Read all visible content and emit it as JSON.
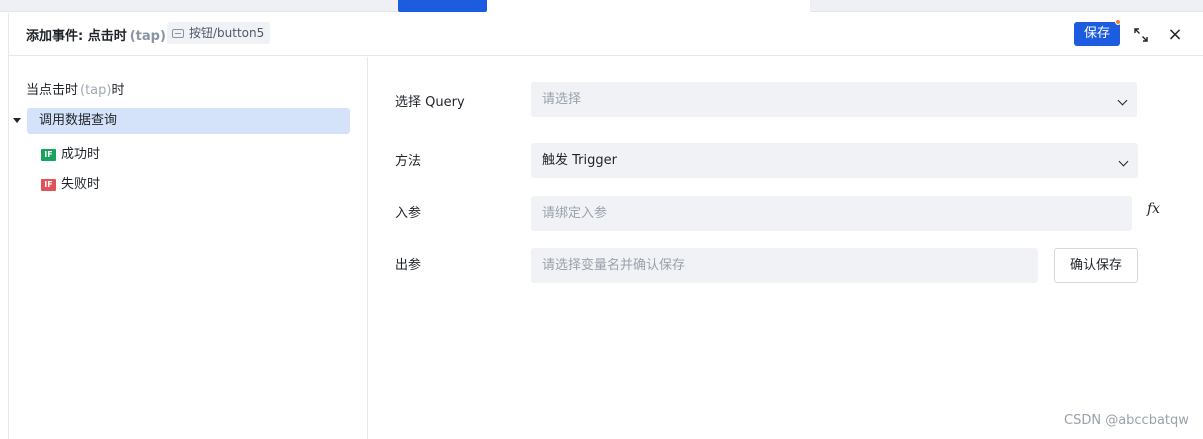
{
  "header": {
    "title": "添加事件: 点击时",
    "event_code": "(tap)",
    "component_tag": "按钮/button5",
    "save_label": "保存",
    "expand_icon": "expand-icon",
    "close_icon": "close-icon",
    "close_glyph": "×"
  },
  "tree": {
    "root_label": "当点击时",
    "root_code": "(tap)",
    "root_suffix": "时",
    "action_label": "调用数据查询",
    "success": {
      "badge": "IF",
      "label": "成功时"
    },
    "failure": {
      "badge": "IF",
      "label": "失败时"
    }
  },
  "form": {
    "query": {
      "label": "选择 Query",
      "placeholder": "请选择"
    },
    "method": {
      "label": "方法",
      "value": "触发 Trigger"
    },
    "input_param": {
      "label": "入参",
      "placeholder": "请绑定入参",
      "fx_label": "fx"
    },
    "output_param": {
      "label": "出参",
      "placeholder": "请选择变量名并确认保存",
      "confirm_label": "确认保存"
    }
  },
  "watermark": "CSDN @abccbatqw",
  "colors": {
    "primary": "#1d5cdf",
    "selected_bg": "#d5e3fa",
    "success_badge": "#17a35c",
    "failure_badge": "#e25359",
    "notification_dot": "#f07f2c"
  }
}
